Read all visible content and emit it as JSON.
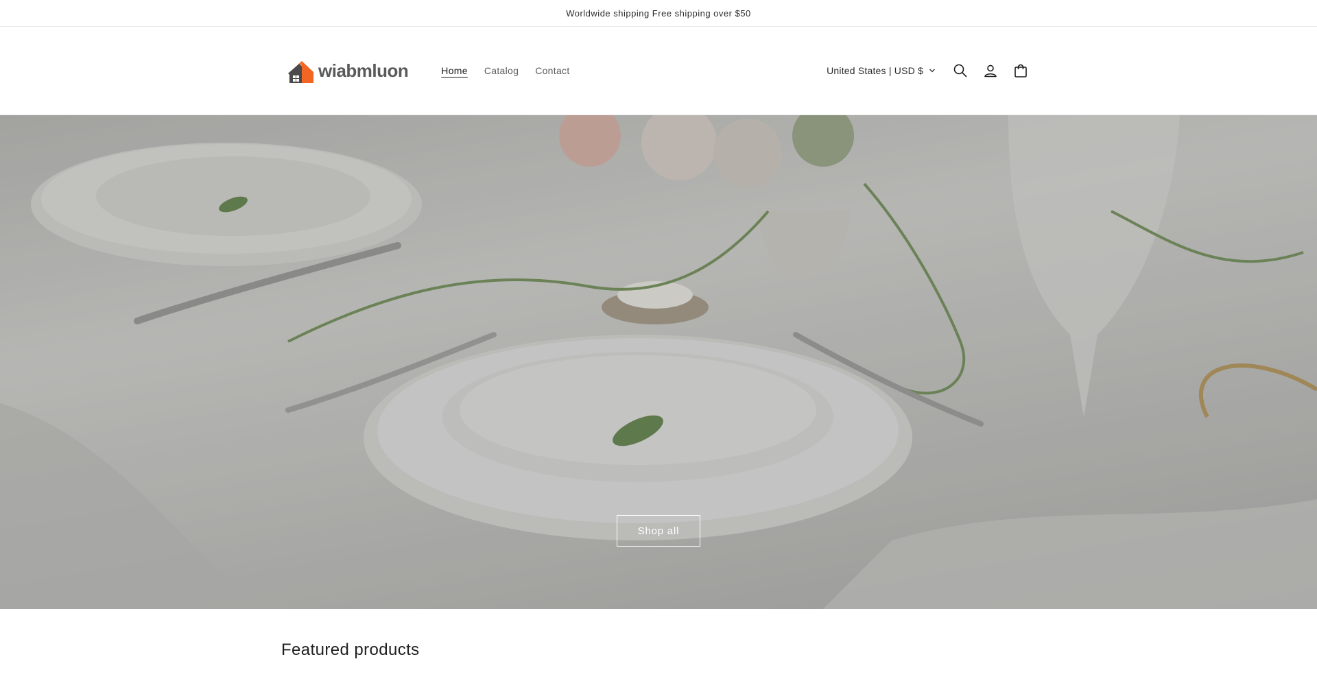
{
  "announcement": {
    "text": "Worldwide shipping Free shipping over $50"
  },
  "header": {
    "logo_text": "wiabmluon",
    "nav": [
      {
        "label": "Home",
        "active": true
      },
      {
        "label": "Catalog",
        "active": false
      },
      {
        "label": "Contact",
        "active": false
      }
    ],
    "localization": "United States | USD $",
    "icons": [
      "search-icon",
      "account-icon",
      "cart-icon"
    ]
  },
  "hero": {
    "button_label": "Shop all"
  },
  "featured": {
    "title": "Featured products"
  },
  "colors": {
    "logo_accent": "#f26522",
    "logo_house": "#4a4a4a",
    "text": "#121212"
  }
}
